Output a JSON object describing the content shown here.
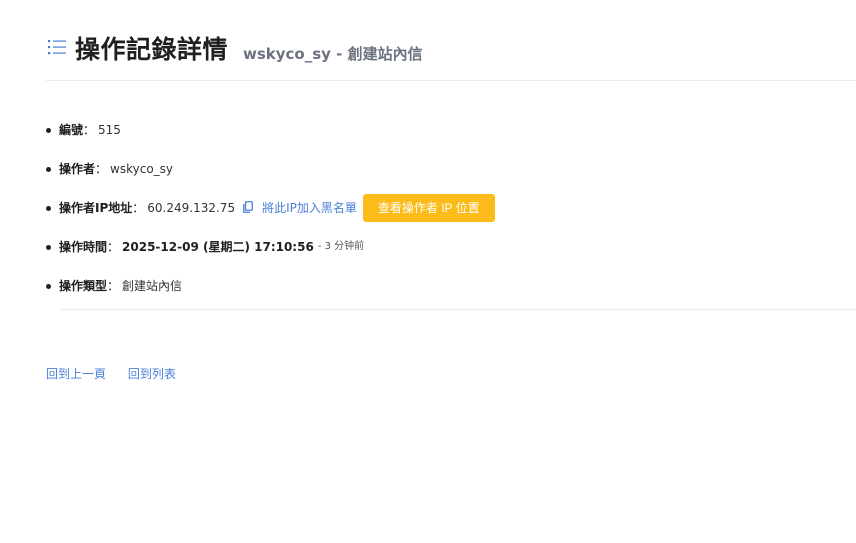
{
  "header": {
    "title": "操作記錄詳情",
    "subtitle": "wskyco_sy - 創建站內信"
  },
  "details": {
    "id": {
      "label": "編號",
      "value": "515"
    },
    "operator": {
      "label": "操作者",
      "value": "wskyco_sy"
    },
    "ip": {
      "label": "操作者IP地址",
      "value": "60.249.132.75",
      "blacklist_link": "將此IP加入黑名單",
      "locate_button": "查看操作者 IP 位置"
    },
    "time": {
      "label": "操作時間",
      "value": "2025-12-09 (星期二) 17:10:56",
      "relative": "- 3 分钟前"
    },
    "type": {
      "label": "操作類型",
      "value": "創建站內信"
    }
  },
  "separator": "：",
  "footer": {
    "back_link": "回到上一頁",
    "list_link": "回到列表"
  },
  "colors": {
    "link": "#4a7fd6",
    "button": "#fbbc1a"
  },
  "icons": {
    "header": "list-icon",
    "copy": "copy-icon"
  }
}
